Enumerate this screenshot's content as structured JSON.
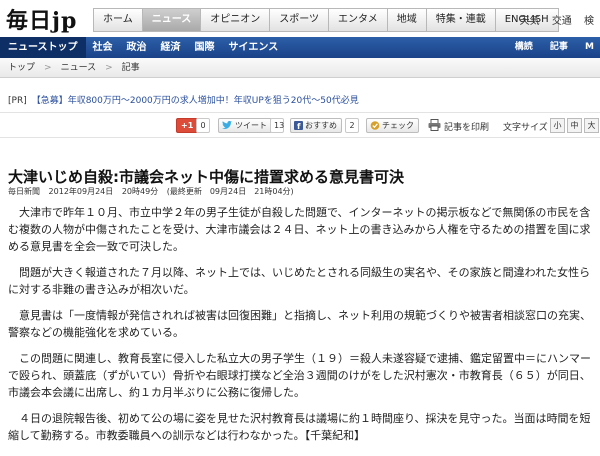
{
  "header": {
    "logo": "毎日jp",
    "nav": [
      "ホーム",
      "ニュース",
      "オピニオン",
      "スポーツ",
      "エンタメ",
      "地域",
      "特集・連載",
      "ENGLISH"
    ],
    "util": [
      "天気",
      "交通",
      "検"
    ]
  },
  "subnav": {
    "items": [
      "ニューストップ",
      "社会",
      "政治",
      "経済",
      "国際",
      "サイエンス"
    ],
    "right": [
      "構読",
      "記事",
      "M"
    ]
  },
  "breadcrumb": [
    "トップ",
    "ニュース",
    "記事"
  ],
  "pr": {
    "tag": "[PR]",
    "text": "【急募】年収800万円～2000万円の求人増加中！年収UPを狙う20代～50代必見"
  },
  "social": {
    "gplus_label": "+1",
    "gplus_count": "0",
    "tweet_label": "ツイート",
    "tweet_count": "13",
    "osusume_label": "おすすめ",
    "osusume_count": "2",
    "check_label": "チェック",
    "print_label": "記事を印刷",
    "fontsize_label": "文字サイズ",
    "fontsizes": [
      "小",
      "中",
      "大"
    ]
  },
  "article": {
    "title": "大津いじめ自殺:市議会ネット中傷に措置求める意見書可決",
    "meta": {
      "source": "毎日新聞",
      "date": "2012年09月24日",
      "time": "20時49分",
      "updated": "(最終更新　09月24日　21時04分)"
    },
    "paragraphs": [
      "大津市で昨年１０月、市立中学２年の男子生徒が自殺した問題で、インターネットの掲示板などで無関係の市民を含む複数の人物が中傷されたことを受け、大津市議会は２４日、ネット上の書き込みから人権を守るための措置を国に求める意見書を全会一致で可決した。",
      "問題が大きく報道された７月以降、ネット上では、いじめたとされる同級生の実名や、その家族と間違われた女性らに対する非難の書き込みが相次いだ。",
      "意見書は「一度情報が発信されれば被害は回復困難」と指摘し、ネット利用の規範づくりや被害者相談窓口の充実、警察などの機能強化を求めている。",
      "この問題に関連し、教育長室に侵入した私立大の男子学生（１９）＝殺人未遂容疑で逮捕、鑑定留置中＝にハンマーで殴られ、頭蓋底（ずがいてい）骨折や右眼球打撲など全治３週間のけがをした沢村憲次・市教育長（６５）が同日、市議会本会議に出席し、約１カ月半ぶりに公務に復帰した。",
      "４日の退院報告後、初めて公の場に姿を見せた沢村教育長は議場に約１時間座り、採決を見守った。当面は時間を短縮して勤務する。市教委職員への訓示などは行わなかった。【千葉紀和】"
    ]
  },
  "colors": {
    "subnav_blue": "#1a4288",
    "link_blue": "#2a4f9e",
    "gplus_red": "#dd4b39"
  }
}
